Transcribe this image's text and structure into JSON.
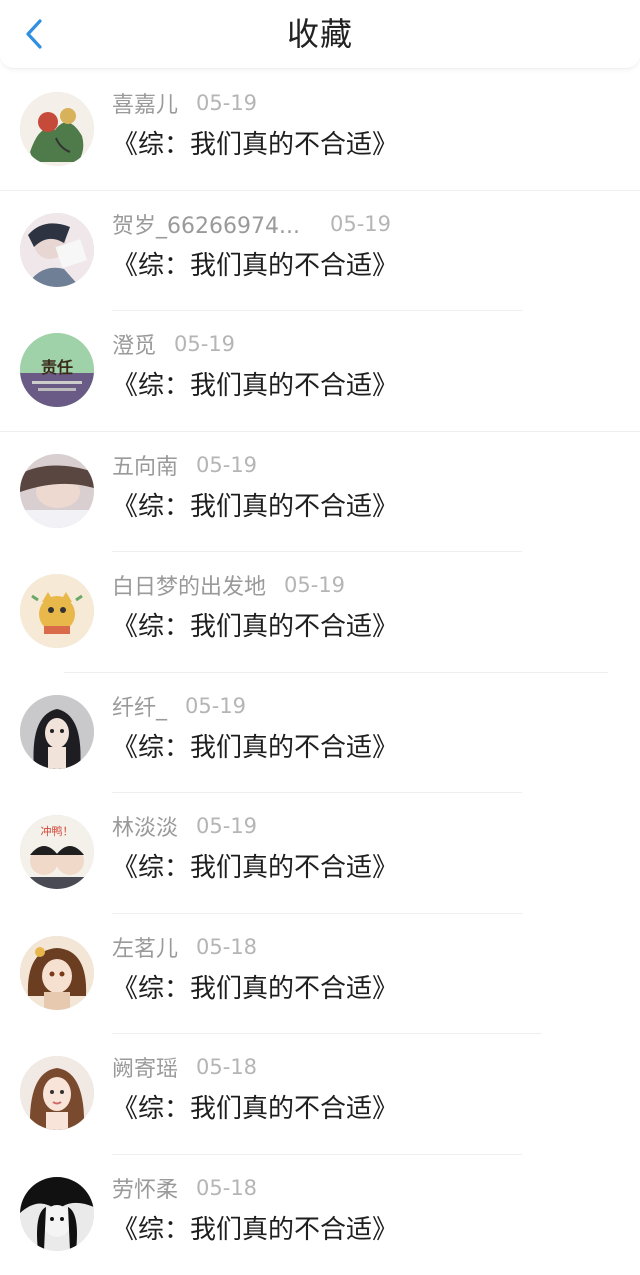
{
  "header": {
    "title": "收藏",
    "back_icon": "chevron-left-icon",
    "accent": "#2f8fe0"
  },
  "items": [
    {
      "name": "喜嘉儿",
      "date": "05-19",
      "book": "《综：我们真的不合适》",
      "avatar_text": ""
    },
    {
      "name": "贺岁_66266974...",
      "date": "05-19",
      "book": "《综：我们真的不合适》",
      "avatar_text": ""
    },
    {
      "name": "澄觅",
      "date": "05-19",
      "book": "《综：我们真的不合适》",
      "avatar_text": "责任"
    },
    {
      "name": "五向南",
      "date": "05-19",
      "book": "《综：我们真的不合适》",
      "avatar_text": ""
    },
    {
      "name": "白日梦的出发地",
      "date": "05-19",
      "book": "《综：我们真的不合适》",
      "avatar_text": ""
    },
    {
      "name": "纤纤_",
      "date": "05-19",
      "book": "《综：我们真的不合适》",
      "avatar_text": ""
    },
    {
      "name": "林淡淡",
      "date": "05-19",
      "book": "《综：我们真的不合适》",
      "avatar_text": "冲鸭！"
    },
    {
      "name": "左茗儿",
      "date": "05-18",
      "book": "《综：我们真的不合适》",
      "avatar_text": ""
    },
    {
      "name": "阙寄瑶",
      "date": "05-18",
      "book": "《综：我们真的不合适》",
      "avatar_text": ""
    },
    {
      "name": "劳怀柔",
      "date": "05-18",
      "book": "《综：我们真的不合适》",
      "avatar_text": ""
    }
  ]
}
